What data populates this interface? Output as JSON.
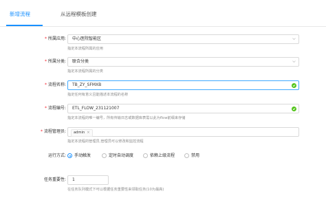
{
  "tabs": [
    {
      "label": "新增流程",
      "active": true
    },
    {
      "label": "从远程模板创建",
      "active": false
    }
  ],
  "form": {
    "application": {
      "label": "所属应用:",
      "required": true,
      "value": "中心医院智能区",
      "hint": "指定本流程所属的应用"
    },
    "category": {
      "label": "所属分类:",
      "required": true,
      "value": "联合分类",
      "hint": "指定本流程所属的分类"
    },
    "flow_name": {
      "label": "流程名称:",
      "required": true,
      "value": "TB_ZY_SFMXB",
      "hint": "指定任何有意义且能描述本流程的名称"
    },
    "flow_code": {
      "label": "流程编号:",
      "required": true,
      "value": "ETL_FLOW_231121007",
      "hint": "指定本流程的唯一编号，所有传输日志或数据库表需以此为flow前缀来存储"
    },
    "flow_admin": {
      "label": "流程管理员:",
      "required": true,
      "tag": "admin",
      "tag_close": "×",
      "hint": "指定本流程的管理员,管理员可以修改和监控流程"
    },
    "run_mode": {
      "label": "运行方式:",
      "required": false,
      "options": [
        {
          "label": "手动触发",
          "selected": true
        },
        {
          "label": "定时自动调度",
          "selected": false
        },
        {
          "label": "依赖上级流程",
          "selected": false
        },
        {
          "label": "禁用",
          "selected": false
        }
      ]
    },
    "task_priority": {
      "label": "任务重要性:",
      "required": false,
      "value": "1",
      "hint": "在任务队列模式下可以根据任务重要性来领取任务(10为最高)"
    }
  },
  "colors": {
    "accent": "#1890ff",
    "success": "#52c41a",
    "required": "#f5222d"
  }
}
